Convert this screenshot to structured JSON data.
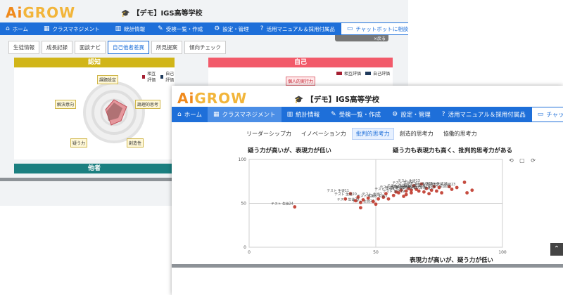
{
  "app": {
    "logo_prefix": "Ai",
    "logo_rest": "GROW",
    "school": "【デモ】IGS高等学校"
  },
  "back_window": {
    "nav": [
      {
        "label": "ホーム",
        "icon": "home-icon"
      },
      {
        "label": "クラスマネジメント",
        "icon": "chart-board-icon"
      },
      {
        "label": "統計情報",
        "icon": "stats-icon"
      },
      {
        "label": "受検一覧・作成",
        "icon": "pencil-icon"
      },
      {
        "label": "設定・管理",
        "icon": "gear-icon"
      },
      {
        "label": "活用マニュアル＆採用付属品",
        "icon": "help-icon"
      },
      {
        "label": "チャットボットに相談",
        "icon": "chat-icon"
      }
    ],
    "subtabs": [
      "生徒情報",
      "成長記録",
      "面談ナビ",
      "自己他者差異",
      "所見提案",
      "傾向チェック"
    ],
    "back_button": "×戻る",
    "panels": {
      "ninchi": "認知",
      "jiko": "自己",
      "tasha": "他者"
    },
    "legend": {
      "other": "相互評価",
      "self": "自己評価"
    },
    "radar_labels": [
      "課題設定",
      "論理的思考",
      "創造性",
      "疑う力",
      "解決意向"
    ],
    "jiko_labels": [
      "個人的実行力"
    ],
    "colors": {
      "ninchi": "#d1b518",
      "jiko": "#f25a6a",
      "tasha": "#1b7f80",
      "other": "#a51f32",
      "self": "#1f3a5c"
    }
  },
  "front_window": {
    "nav": [
      {
        "label": "ホーム",
        "icon": "home-icon"
      },
      {
        "label": "クラスマネジメント",
        "icon": "chart-board-icon"
      },
      {
        "label": "統計情報",
        "icon": "stats-icon"
      },
      {
        "label": "受検一覧・作成",
        "icon": "pencil-icon"
      },
      {
        "label": "設定・管理",
        "icon": "gear-icon"
      },
      {
        "label": "活用マニュアル＆採用付属品",
        "icon": "help-icon"
      },
      {
        "label": "チャットボットに相談",
        "icon": "chat-icon"
      }
    ],
    "tabs": [
      "リーダーシップ力",
      "イノベーション力",
      "批判的思考力",
      "創造的思考力",
      "協働的思考力"
    ],
    "active_tab": 2,
    "quadrants": {
      "top_left": "疑う力が高いが、表現力が低い",
      "top_right": "疑う力も表現力も高く、批判的思考力がある",
      "bottom_right": "表現力が高いが、疑う力が低い"
    },
    "tools": "⟲ ▢ ⟳"
  },
  "chart_data": {
    "type": "scatter",
    "xlim": [
      0,
      100
    ],
    "ylim": [
      0,
      100
    ],
    "xticks": [
      0,
      50,
      100
    ],
    "yticks": [
      0,
      50,
      100
    ],
    "color": "#c0392b",
    "points": [
      {
        "x": 51,
        "y": 55,
        "label": "テスト 生徒1"
      },
      {
        "x": 53,
        "y": 57,
        "label": "テスト 生徒2"
      },
      {
        "x": 55,
        "y": 55,
        "label": "テスト 生徒3"
      },
      {
        "x": 58,
        "y": 63,
        "label": "テスト 生徒4"
      },
      {
        "x": 60,
        "y": 65,
        "label": "テスト 生徒5"
      },
      {
        "x": 62,
        "y": 64,
        "label": "テスト 生徒6"
      },
      {
        "x": 63,
        "y": 67,
        "label": "テスト 生徒7"
      },
      {
        "x": 64,
        "y": 65,
        "label": "テスト 生徒8"
      },
      {
        "x": 65,
        "y": 70,
        "label": "テスト 生徒9"
      },
      {
        "x": 66,
        "y": 66,
        "label": "テスト 生徒10"
      },
      {
        "x": 40,
        "y": 61,
        "label": "テスト 生徒11"
      },
      {
        "x": 67,
        "y": 64,
        "label": "テスト 生徒12"
      },
      {
        "x": 68,
        "y": 72,
        "label": "テスト 生徒13"
      },
      {
        "x": 70,
        "y": 67,
        "label": "テスト 生徒14"
      },
      {
        "x": 72,
        "y": 65,
        "label": "テスト 生徒15"
      },
      {
        "x": 73,
        "y": 69,
        "label": "テスト 生徒16"
      },
      {
        "x": 74,
        "y": 64,
        "label": "テスト 生徒17"
      },
      {
        "x": 75,
        "y": 68,
        "label": "テスト 生徒18"
      },
      {
        "x": 62,
        "y": 60,
        "label": "テスト 生徒19"
      },
      {
        "x": 43,
        "y": 57,
        "label": "テスト 生徒20"
      },
      {
        "x": 79,
        "y": 69,
        "label": "テスト 生徒21"
      },
      {
        "x": 80,
        "y": 66,
        "label": "テスト 生徒22"
      },
      {
        "x": 82,
        "y": 68,
        "label": "テスト 生徒23"
      },
      {
        "x": 18,
        "y": 46,
        "label": "テスト 生徒24"
      },
      {
        "x": 44,
        "y": 51,
        "label": "テスト 生徒25"
      },
      {
        "x": 50,
        "y": 49,
        "label": "テスト 生徒26"
      },
      {
        "x": 47,
        "y": 56,
        "label": ""
      },
      {
        "x": 45,
        "y": 54,
        "label": ""
      },
      {
        "x": 42,
        "y": 53,
        "label": ""
      },
      {
        "x": 49,
        "y": 52,
        "label": ""
      },
      {
        "x": 38,
        "y": 55,
        "label": ""
      },
      {
        "x": 44,
        "y": 45,
        "label": ""
      },
      {
        "x": 54,
        "y": 61,
        "label": ""
      },
      {
        "x": 57,
        "y": 59,
        "label": ""
      },
      {
        "x": 59,
        "y": 62,
        "label": ""
      },
      {
        "x": 61,
        "y": 58,
        "label": ""
      },
      {
        "x": 64,
        "y": 62,
        "label": ""
      },
      {
        "x": 69,
        "y": 63,
        "label": ""
      },
      {
        "x": 71,
        "y": 61,
        "label": ""
      },
      {
        "x": 76,
        "y": 62,
        "label": ""
      },
      {
        "x": 85,
        "y": 74,
        "label": ""
      },
      {
        "x": 88,
        "y": 65,
        "label": ""
      },
      {
        "x": 86,
        "y": 62,
        "label": ""
      }
    ]
  }
}
